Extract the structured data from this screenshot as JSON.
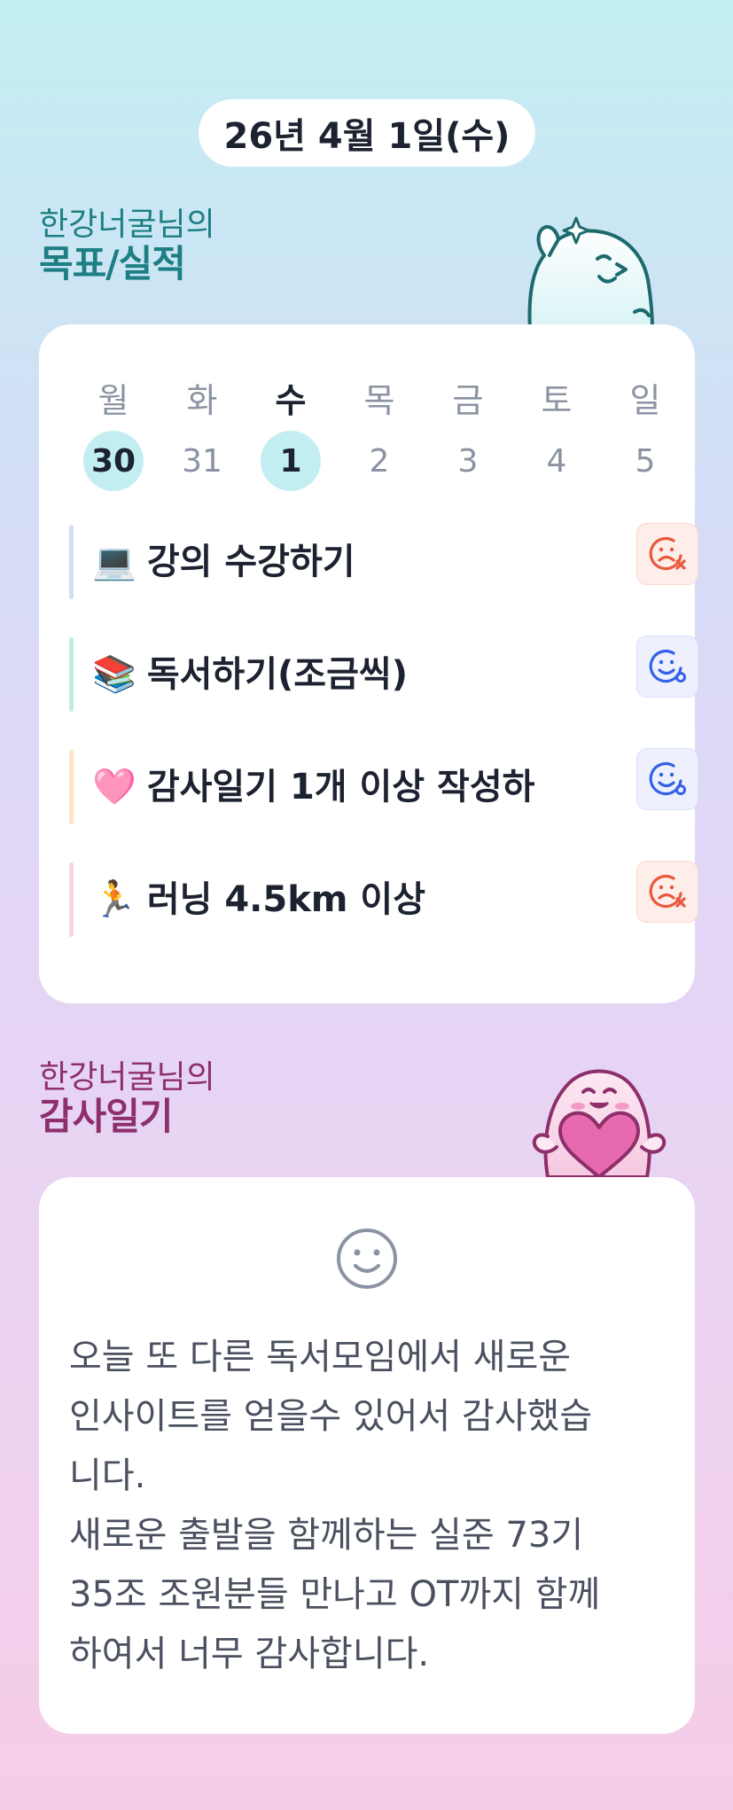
{
  "header": {
    "date": "26년 4월 1일(수)"
  },
  "goals_section": {
    "owner_label": "한강너굴님의",
    "title": "목표/실적"
  },
  "week": {
    "days": [
      {
        "name": "월",
        "num": "30",
        "selected": true,
        "today": false
      },
      {
        "name": "화",
        "num": "31",
        "selected": false,
        "today": false
      },
      {
        "name": "수",
        "num": "1",
        "selected": false,
        "today": true
      },
      {
        "name": "목",
        "num": "2",
        "selected": false,
        "today": false
      },
      {
        "name": "금",
        "num": "3",
        "selected": false,
        "today": false
      },
      {
        "name": "토",
        "num": "4",
        "selected": false,
        "today": false
      },
      {
        "name": "일",
        "num": "5",
        "selected": false,
        "today": false
      }
    ]
  },
  "goals": [
    {
      "emoji": "💻",
      "label": "강의 수강하기",
      "status": "fail",
      "bar_color": "#d5def5"
    },
    {
      "emoji": "📚",
      "label": "독서하기(조금씩)",
      "status": "done",
      "bar_color": "#bfeede"
    },
    {
      "emoji": "🩷",
      "label": "감사일기 1개 이상 작성하",
      "status": "done",
      "bar_color": "#fde3c4"
    },
    {
      "emoji": "🏃",
      "label": "러닝 4.5km 이상",
      "status": "fail",
      "bar_color": "#f8d2e6"
    }
  ],
  "gratitude_section": {
    "owner_label": "한강너굴님의",
    "title": "감사일기"
  },
  "gratitude": {
    "mood_icon": "smile-icon",
    "text": "오늘 또 다른 독서모임에서 새로운\n인사이트를 얻을수 있어서 감사했습\n니다.\n새로운 출발을 함께하는 실준 73기\n35조 조원분들 만나고 OT까지 함께\n하여서 너무 감사합니다."
  },
  "colors": {
    "goals_accent": "#1d7f84",
    "gratitude_accent": "#8e2f6b",
    "fail": "#e8593d",
    "done": "#3461e8",
    "day_highlight": "#c2eef2"
  }
}
